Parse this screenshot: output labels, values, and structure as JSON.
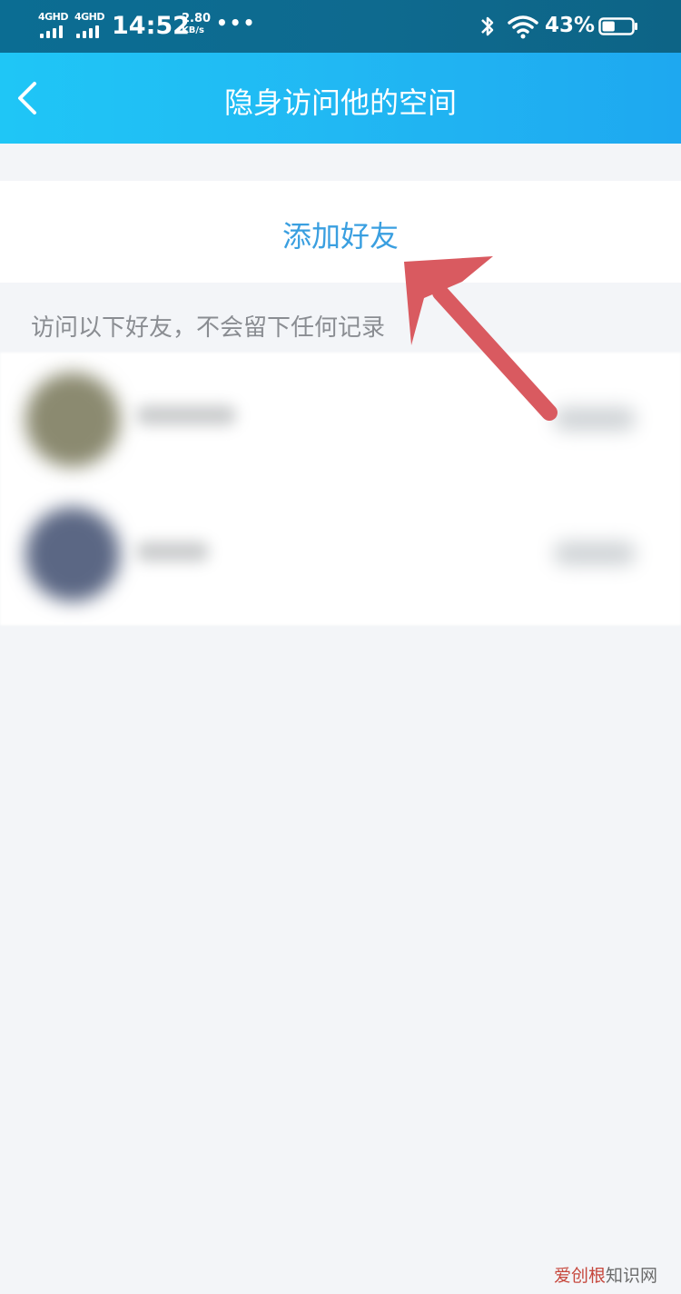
{
  "status_bar": {
    "network_1": "4GHD",
    "network_2": "4GHD",
    "time": "14:52",
    "speed_value": "2.80",
    "speed_unit": "KB/s",
    "more": "•••",
    "battery_percent": "43%",
    "battery_level": 0.43
  },
  "header": {
    "title": "隐身访问他的空间",
    "back_icon": "chevron-left-icon"
  },
  "add_friend": {
    "label": "添加好友"
  },
  "hint": "访问以下好友，不会留下任何记录",
  "watermark": {
    "brand": "爱创根",
    "suffix": "知识网"
  },
  "colors": {
    "header_gradient_start": "#1fc6f6",
    "header_gradient_end": "#1ea8f0",
    "accent_blue": "#3a9fe0",
    "annotation_arrow": "#d95a60"
  }
}
